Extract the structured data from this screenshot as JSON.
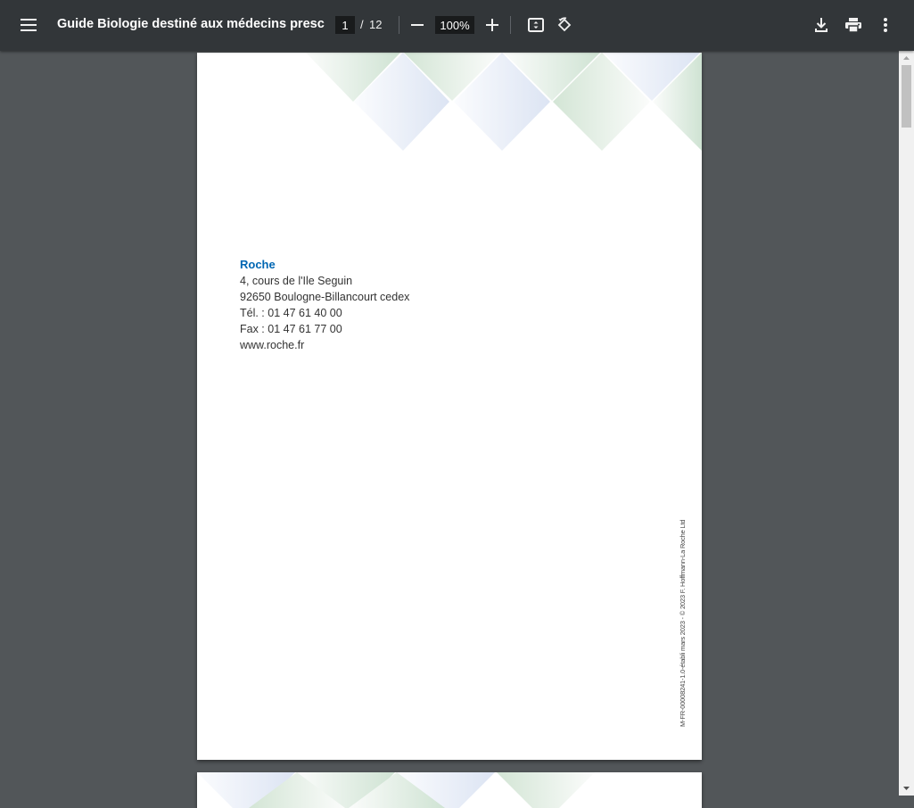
{
  "toolbar": {
    "title": "Guide Biologie destiné aux médecins prescri...",
    "page_current": "1",
    "page_separator": "/",
    "page_total": "12",
    "zoom": "100%",
    "icons": [
      "menu-icon",
      "zoom-out-icon",
      "zoom-in-icon",
      "fit-page-icon",
      "rotate-icon",
      "download-icon",
      "print-icon",
      "more-vert-icon"
    ]
  },
  "page1": {
    "company": "Roche",
    "address_line1": "4, cours de l'Ile Seguin",
    "address_line2": "92650 Boulogne-Billancourt cedex",
    "phone": "Tél. : 01 47 61 40 00",
    "fax": "Fax : 01 47 61 77 00",
    "website": "www.roche.fr",
    "legal_text": "M-FR-00008241-1.0-établi mars 2023 - © 2023 F. Hoffmann-La Roche Ltd",
    "colors": {
      "company": "#0066b3",
      "deco_green": "#cfe3d3",
      "deco_blue": "#dce4f3"
    }
  }
}
